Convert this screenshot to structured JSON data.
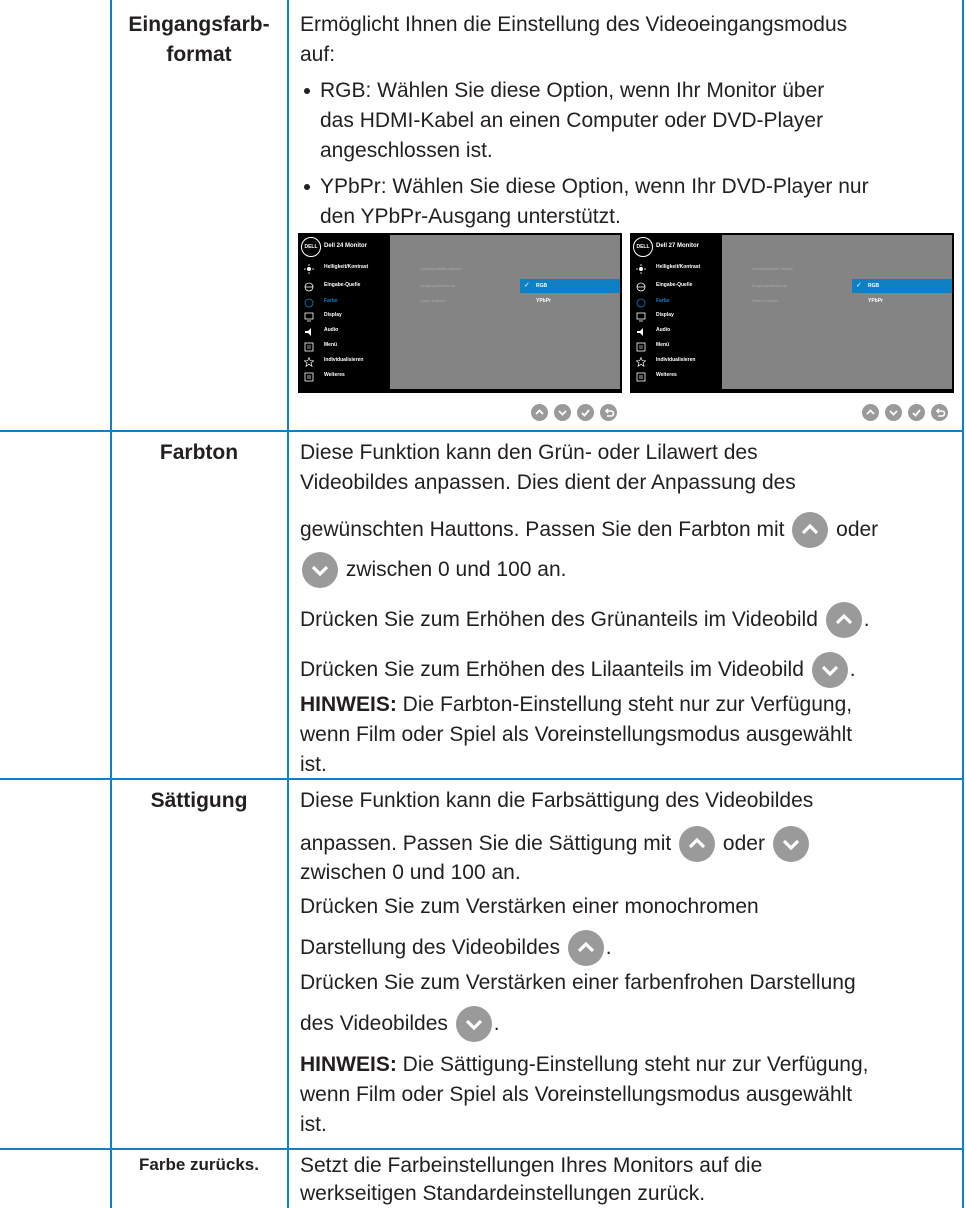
{
  "rows": {
    "eingangsfarbformat": {
      "name_line1": "Eingangsfarb-",
      "name_line2": "format",
      "intro_line1": "Ermöglicht Ihnen die Einstellung des Videoeingangsmodus",
      "intro_line2": "auf:",
      "rgb_line1": "RGB: Wählen Sie diese Option, wenn Ihr Monitor über",
      "rgb_line2": "das HDMI-Kabel an einen Computer oder DVD-Player",
      "rgb_line3": "angeschlossen ist.",
      "ypbpr_line1": "YPbPr: Wählen Sie diese Option, wenn Ihr DVD-Player nur",
      "ypbpr_line2": "den YPbPr-Ausgang unterstützt."
    },
    "farbton": {
      "name": "Farbton",
      "line1": "Diese Funktion kann den Grün- oder Lilawert des",
      "line2": "Videobildes anpassen. Dies dient der Anpassung des",
      "line3a": "gewünschten Hauttons. Passen Sie den Farbton mit",
      "line3b": "oder",
      "line4": "zwischen 0 und 100 an.",
      "line5": "Drücken Sie zum Erhöhen des Grünanteils im Videobild",
      "line6": "Drücken Sie zum Erhöhen des Lilaanteils im Videobild",
      "note_label": "HINWEIS:",
      "note_line1": "Die Farbton-Einstellung steht nur zur Verfügung,",
      "note_line2": "wenn Film oder Spiel als Voreinstellungsmodus ausgewählt",
      "note_line3": "ist."
    },
    "saettigung": {
      "name": "Sättigung",
      "line1": "Diese Funktion kann die Farbsättigung des Videobildes",
      "line2a": "anpassen. Passen Sie die Sättigung mit",
      "line2b": "oder",
      "line3": "zwischen 0 und 100 an.",
      "line4": "Drücken Sie zum Verstärken einer monochromen",
      "line5": "Darstellung des Videobildes",
      "line6": "Drücken Sie zum Verstärken einer farbenfrohen Darstellung",
      "line7": "des Videobildes",
      "note_label": "HINWEIS:",
      "note_line1": "Die Sättigung-Einstellung steht nur zur Verfügung,",
      "note_line2": "wenn Film oder Spiel als Voreinstellungsmodus ausgewählt",
      "note_line3": "ist."
    },
    "farbe_zuruecks": {
      "name": "Farbe zurücks.",
      "line1": "Setzt die Farbeinstellungen Ihres Monitors auf die",
      "line2": "werkseitigen Standardeinstellungen zurück."
    }
  },
  "osd_left": {
    "logo": "DELL",
    "title": "Dell 24 Monitor",
    "menu": [
      "Helligkeit/Kontrast",
      "Eingabe-Quelle",
      "Farbe",
      "Display",
      "Audio",
      "Menü",
      "Individualisieren",
      "Weiteres"
    ],
    "labels": [
      "Voreingestellter Modus",
      "Eingangsfarbformat",
      "Farbe zurücks."
    ],
    "options": [
      "RGB",
      "YPbPr"
    ]
  },
  "osd_right": {
    "logo": "DELL",
    "title": "Dell 27 Monitor",
    "menu": [
      "Helligkeit/Kontrast",
      "Eingabe-Quelle",
      "Farbe",
      "Display",
      "Audio",
      "Menü",
      "Individualisieren",
      "Weiteres"
    ],
    "labels": [
      "Voreingestellter Modus",
      "Eingangsfarbformat",
      "Farbe zurücks."
    ],
    "options": [
      "RGB",
      "YPbPr"
    ]
  },
  "colors": {
    "rule": "#0e80c4",
    "osd_bg": "#000000",
    "osd_panel": "#848484",
    "highlight": "#0e80c4",
    "button": "#9a9a9a"
  }
}
